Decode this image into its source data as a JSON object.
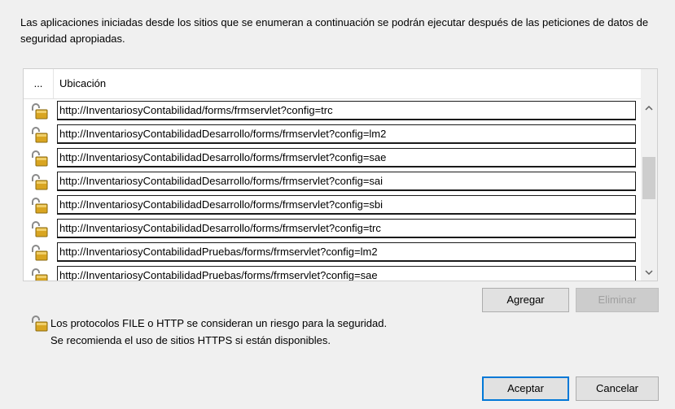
{
  "dialog": {
    "description": "Las aplicaciones iniciadas desde los sitios que se enumeran a continuación se podrán ejecutar después de las peticiones de datos de seguridad apropiadas."
  },
  "table": {
    "col_dots": "...",
    "col_location": "Ubicación",
    "rows": [
      {
        "icon": "unlocked-padlock-icon",
        "url": "http://InventariosyContabilidad/forms/frmservlet?config=trc"
      },
      {
        "icon": "unlocked-padlock-icon",
        "url": "http://InventariosyContabilidadDesarrollo/forms/frmservlet?config=lm2"
      },
      {
        "icon": "unlocked-padlock-icon",
        "url": "http://InventariosyContabilidadDesarrollo/forms/frmservlet?config=sae"
      },
      {
        "icon": "unlocked-padlock-icon",
        "url": "http://InventariosyContabilidadDesarrollo/forms/frmservlet?config=sai"
      },
      {
        "icon": "unlocked-padlock-icon",
        "url": "http://InventariosyContabilidadDesarrollo/forms/frmservlet?config=sbi"
      },
      {
        "icon": "unlocked-padlock-icon",
        "url": "http://InventariosyContabilidadDesarrollo/forms/frmservlet?config=trc"
      },
      {
        "icon": "unlocked-padlock-icon",
        "url": "http://InventariosyContabilidadPruebas/forms/frmservlet?config=lm2"
      },
      {
        "icon": "unlocked-padlock-icon",
        "url": "http://InventariosyContabilidadPruebas/forms/frmservlet?config=sae"
      }
    ]
  },
  "buttons": {
    "add": "Agregar",
    "remove": "Eliminar",
    "ok": "Aceptar",
    "cancel": "Cancelar"
  },
  "warning": {
    "icon": "unlocked-padlock-icon",
    "line1": "Los protocolos FILE o HTTP se consideran un riesgo para la seguridad.",
    "line2": "Se recomienda el uso de sitios HTTPS si están disponibles."
  },
  "colors": {
    "padlock_body": "#d9a521",
    "focus_border": "#0078d7"
  }
}
